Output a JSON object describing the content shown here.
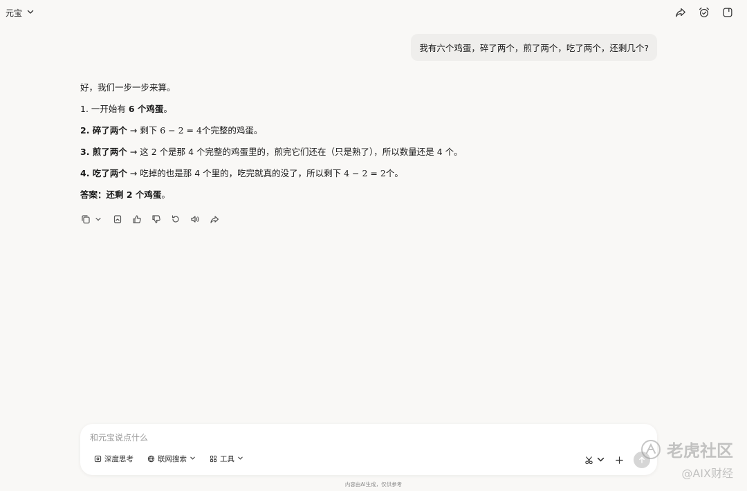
{
  "header": {
    "app_name": "元宝"
  },
  "conversation": {
    "user_message": "我有六个鸡蛋，碎了两个，煎了两个，吃了两个，还剩几个?",
    "answer": {
      "intro": "好，我们一步一步来算。",
      "step1": {
        "prefix": "1. 一开始有 ",
        "bold": "6 个鸡蛋",
        "suffix": "。"
      },
      "step2": {
        "bold": "2. 碎了两个",
        "text_a": " → 剩下 ",
        "math": "6 − 2 = 4",
        "text_b": "个完整的鸡蛋。"
      },
      "step3": {
        "bold": "3. 煎了两个",
        "text": " → 这 2 个是那 4 个完整的鸡蛋里的，煎完它们还在（只是熟了），所以数量还是 4 个。"
      },
      "step4": {
        "bold": "4. 吃了两个",
        "text_a": " → 吃掉的也是那 4 个里的，吃完就真的没了，所以剩下 ",
        "math": "4 − 2 = 2",
        "text_b": "个。"
      },
      "conclusion": {
        "bold": "答案：还剩 2 个鸡蛋",
        "suffix": "。"
      }
    }
  },
  "composer": {
    "placeholder": "和元宝说点什么",
    "tools": {
      "deep_think": "深度思考",
      "web_search": "联网搜索",
      "tools": "工具"
    }
  },
  "footer": {
    "disclaimer": "内容由AI生成，仅供参考"
  },
  "watermark": {
    "line1": "老虎社区",
    "line2": "@AIX财经"
  }
}
